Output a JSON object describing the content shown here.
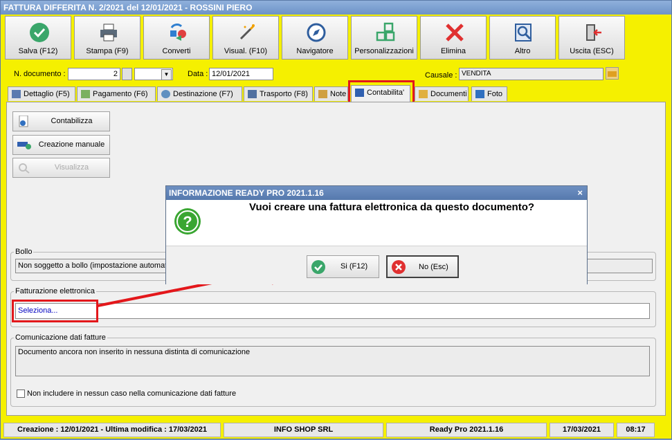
{
  "window": {
    "title": "FATTURA DIFFERITA N. 2/2021 del 12/01/2021 - ROSSINI PIERO"
  },
  "toolbar": [
    {
      "label": "Salva (F12)",
      "icon": "check-icon"
    },
    {
      "label": "Stampa (F9)",
      "icon": "printer-icon"
    },
    {
      "label": "Converti",
      "icon": "convert-icon"
    },
    {
      "label": "Visual. (F10)",
      "icon": "magic-wand-icon"
    },
    {
      "label": "Navigatore",
      "icon": "compass-icon"
    },
    {
      "label": "Personalizzazioni",
      "icon": "grid-icon"
    },
    {
      "label": "Elimina",
      "icon": "delete-x-icon"
    },
    {
      "label": "Altro",
      "icon": "magnifier-icon"
    },
    {
      "label": "Uscita (ESC)",
      "icon": "exit-door-icon"
    }
  ],
  "header": {
    "doc_number_label": "N. documento :",
    "doc_number_value": "2",
    "date_label": "Data :",
    "date_value": "12/01/2021",
    "causale_label": "Causale :",
    "causale_value": "VENDITA"
  },
  "tabs": [
    {
      "label": "Dettaglio (F5)"
    },
    {
      "label": "Pagamento (F6)"
    },
    {
      "label": "Destinazione (F7)"
    },
    {
      "label": "Trasporto (F8)"
    },
    {
      "label": "Note"
    },
    {
      "label": "Contabilita'"
    },
    {
      "label": "Documenti"
    },
    {
      "label": "Foto"
    }
  ],
  "panel": {
    "buttons": {
      "contabilizza": "Contabilizza",
      "creazione": "Creazione manuale",
      "visualizza": "Visualizza"
    },
    "bollo_label": "Bollo",
    "bollo_value": "Non soggetto a bollo (impostazione automatica)",
    "fe_label": "Fatturazione elettronica",
    "fe_value": "Seleziona...",
    "comunicazione_label": "Comunicazione dati fatture",
    "comunicazione_value": "Documento ancora non inserito in nessuna distinta di comunicazione",
    "checkbox_label": "Non includere in nessun caso nella comunicazione dati fatture"
  },
  "dialog": {
    "title": "INFORMAZIONE READY PRO 2021.1.16",
    "message": "Vuoi creare una fattura elettronica da questo documento?",
    "yes_label": "Si (F12)",
    "no_label": "No (Esc)",
    "close": "×"
  },
  "status": {
    "created": "Creazione : 12/01/2021 - Ultima modifica : 17/03/2021",
    "company": "INFO SHOP SRL",
    "product": "Ready Pro 2021.1.16",
    "date": "17/03/2021",
    "time": "08:17"
  },
  "colors": {
    "highlight": "#e3171b",
    "background": "#f5f000",
    "title": "#6d93c8"
  }
}
